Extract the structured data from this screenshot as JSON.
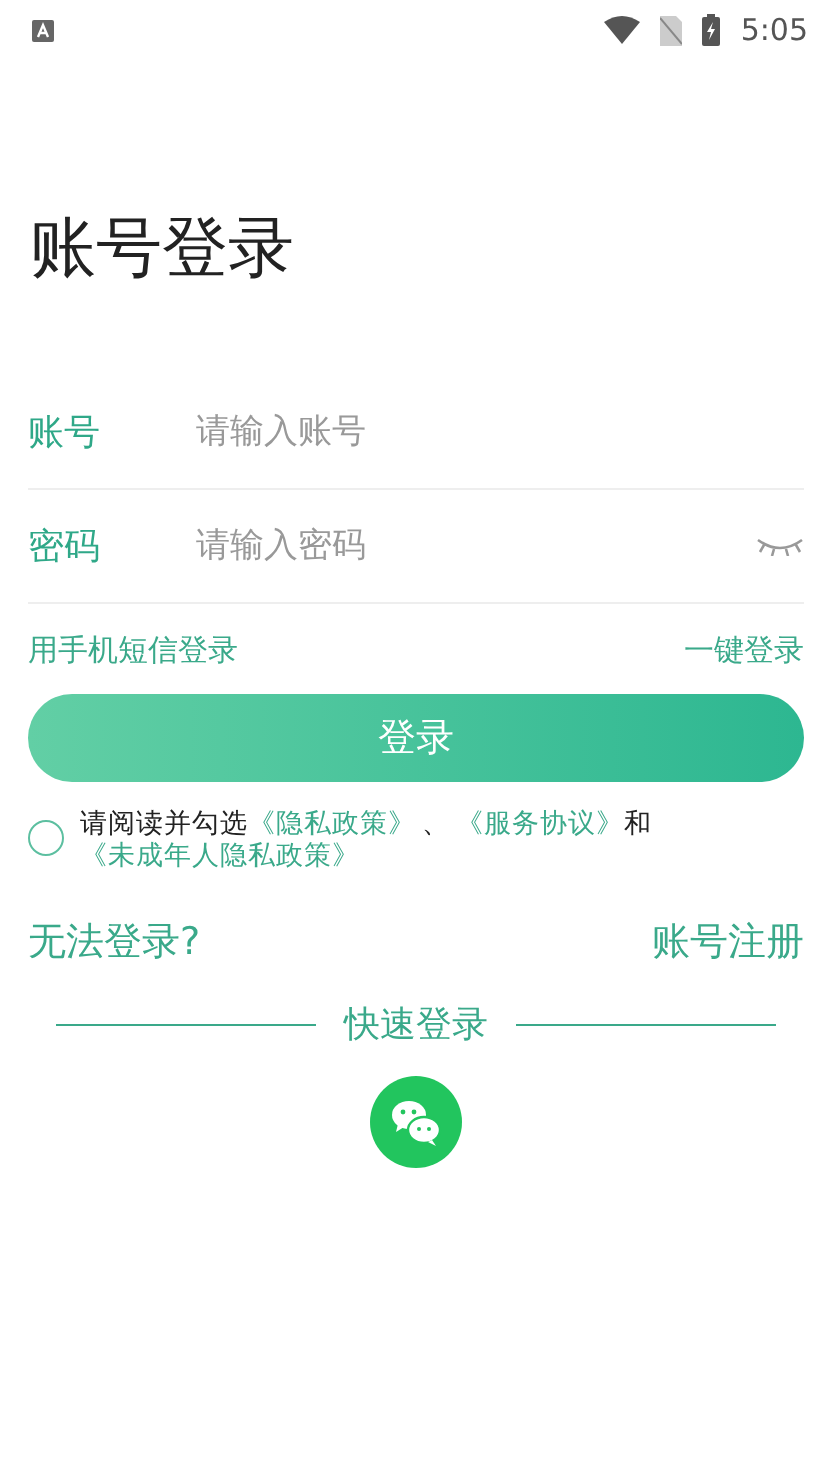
{
  "status_bar": {
    "time": "5:05"
  },
  "title": "账号登录",
  "fields": [
    {
      "kind": "text",
      "label": "账号",
      "placeholder": "请输入账号"
    },
    {
      "kind": "password",
      "label": "密码",
      "placeholder": "请输入密码"
    }
  ],
  "options": {
    "sms_login": "用手机短信登录",
    "one_click_login": "一键登录"
  },
  "login_button": "登录",
  "agreement": {
    "checked": false,
    "prefix": "请阅读并勾选",
    "privacy_link": "《隐私政策》",
    "separator": "、",
    "service_link": "《服务协议》",
    "conjunction": "和",
    "minor_privacy_link": "《未成年人隐私政策》"
  },
  "help": {
    "cannot_login": "无法登录?",
    "register": "账号注册"
  },
  "quick_login": {
    "title": "快速登录"
  }
}
